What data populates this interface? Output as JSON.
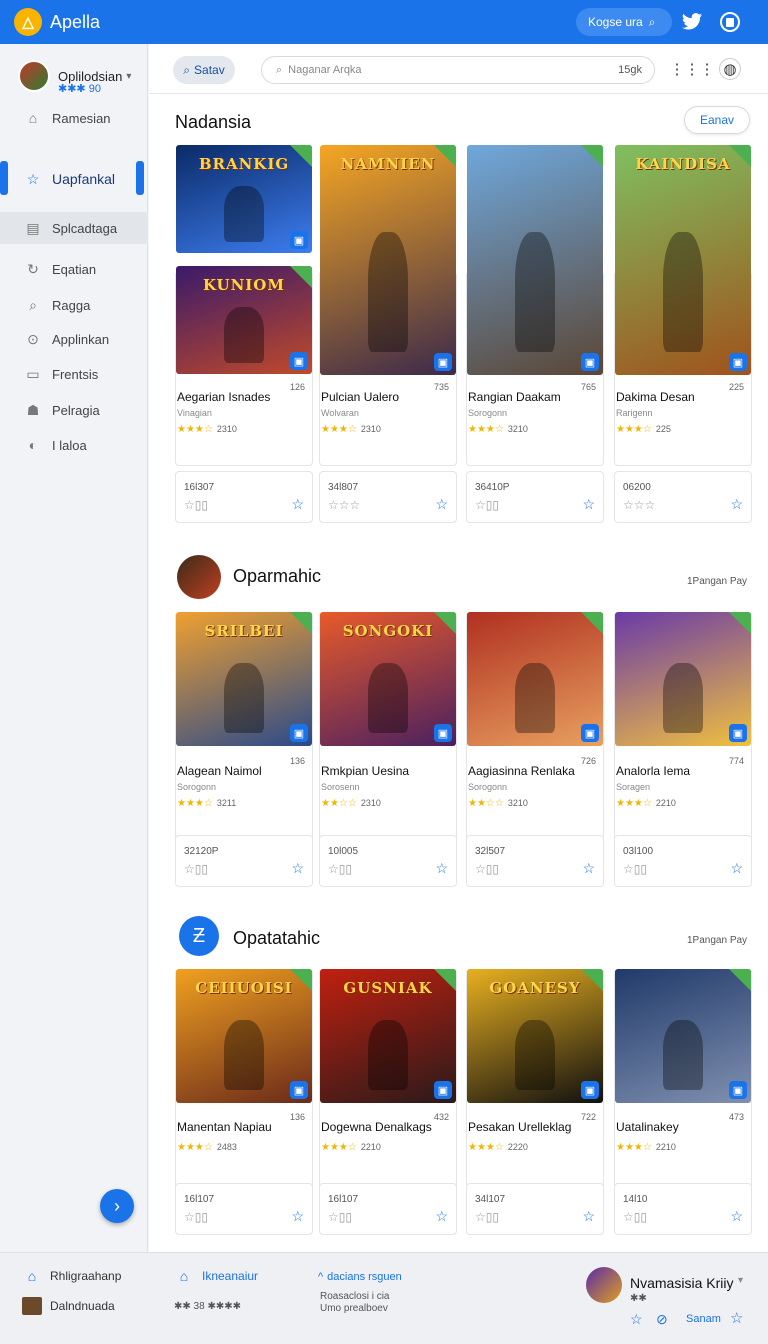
{
  "app": {
    "title": "Apella",
    "logo_glyph": "△"
  },
  "topbar": {
    "search_label": "Kogse ura",
    "search_icon": "search-icon",
    "icons": [
      "twitter-icon",
      "puzzle-icon"
    ]
  },
  "sidebar": {
    "user": {
      "name": "Oplilodsian",
      "score": "✱✱✱ 90"
    },
    "items": [
      {
        "label": "Ramesian",
        "icon": "home-icon"
      },
      {
        "label": "Uapfankal",
        "icon": "star-icon",
        "active": true
      },
      {
        "label": "Splcadtaga",
        "icon": "store-icon",
        "selected": true
      },
      {
        "label": "Eqatian",
        "icon": "update-icon"
      },
      {
        "label": "Ragga",
        "icon": "search-icon"
      },
      {
        "label": "Applinkan",
        "icon": "apps-icon"
      },
      {
        "label": "Frentsis",
        "icon": "library-icon"
      },
      {
        "label": "Pelragia",
        "icon": "people-icon"
      },
      {
        "label": "I laloa",
        "icon": "info-icon"
      }
    ]
  },
  "main": {
    "filter_pill": "Satav",
    "search": {
      "placeholder": "Naganar Arqka",
      "count": "15gk"
    },
    "header_icons": [
      "grid-icon",
      "shield-icon"
    ],
    "sections": [
      {
        "title": "Nadansia",
        "action": "Eanav",
        "games": [
          {
            "name": "Aegarian Isnades",
            "sub": "Vinagian",
            "num": "126",
            "rating": "2310",
            "stars": "★★★☆",
            "price": "16l307",
            "pstars": "☆▯▯",
            "color1": "#0b2a66",
            "color2": "#3d7df0",
            "art_title": "BRANKIG"
          },
          {
            "name": "Pulcian Ualero",
            "sub": "Wolvaran",
            "num": "735",
            "rating": "2310",
            "stars": "★★★☆",
            "price": "34l807",
            "pstars": "☆☆☆",
            "color1": "#f5a623",
            "color2": "#3b2a4a",
            "art_title": "NAMNIEN"
          },
          {
            "name": "Rangian Daakam",
            "sub": "Sorogonn",
            "num": "765",
            "rating": "3210",
            "stars": "★★★☆",
            "price": "36410P",
            "pstars": "☆▯▯",
            "color1": "#6fa8dc",
            "color2": "#5b4636",
            "art_title": ""
          },
          {
            "name": "Dakima Desan",
            "sub": "Rarigenn",
            "num": "225",
            "rating": "225",
            "stars": "★★★☆",
            "price": "06200",
            "pstars": "☆☆☆",
            "color1": "#7fbf5f",
            "color2": "#a0521c",
            "art_title": "KAINDISA"
          }
        ],
        "extra_tile": {
          "color1": "#3a1a6a",
          "color2": "#c04a2a",
          "art_title": "KUNIOM"
        }
      },
      {
        "title": "Oparmahic",
        "action": "1Pangan Pay",
        "games": [
          {
            "name": "Alagean Naimol",
            "sub": "Sorogonn",
            "num": "136",
            "rating": "3211",
            "stars": "★★★☆",
            "price": "32120P",
            "pstars": "☆▯▯",
            "color1": "#f0a030",
            "color2": "#2a4a8a",
            "art_title": "SRILBEI"
          },
          {
            "name": "Rmkpian Uesina",
            "sub": "Sorosenn",
            "num": "",
            "rating": "2310",
            "stars": "★★☆☆",
            "price": "10l005",
            "pstars": "☆▯▯",
            "color1": "#e85a2a",
            "color2": "#4a2060",
            "art_title": "SONGOKI"
          },
          {
            "name": "Aagiasinna Renlaka",
            "sub": "Sorogonn",
            "num": "726",
            "rating": "3210",
            "stars": "★★☆☆",
            "price": "32l507",
            "pstars": "☆▯▯",
            "color1": "#b03020",
            "color2": "#e8a060",
            "art_title": ""
          },
          {
            "name": "Analorla Iema",
            "sub": "Soragen",
            "num": "774",
            "rating": "2210",
            "stars": "★★★☆",
            "price": "03l100",
            "pstars": "☆▯▯",
            "color1": "#6a3aa8",
            "color2": "#f0c040",
            "art_title": ""
          }
        ]
      },
      {
        "title": "Opatatahic",
        "action": "1Pangan Pay",
        "games": [
          {
            "name": "Manentan Napiau",
            "sub": "",
            "num": "136",
            "rating": "2483",
            "stars": "★★★☆",
            "price": "16l107",
            "pstars": "☆▯▯",
            "color1": "#f0a020",
            "color2": "#6a2a1a",
            "art_title": "CEIIUOISI"
          },
          {
            "name": "Dogewna Denalkags",
            "sub": "",
            "num": "432",
            "rating": "2210",
            "stars": "★★★☆",
            "price": "16l107",
            "pstars": "☆▯▯",
            "color1": "#c02010",
            "color2": "#2a1a1a",
            "art_title": "GUSNIAK"
          },
          {
            "name": "Pesakan Urelleklag",
            "sub": "",
            "num": "722",
            "rating": "2220",
            "stars": "★★★☆",
            "price": "34l107",
            "pstars": "☆▯▯",
            "color1": "#e8b020",
            "color2": "#101010",
            "art_title": "GOANESY"
          },
          {
            "name": "Uatalinakey",
            "sub": "",
            "num": "473",
            "rating": "2210",
            "stars": "★★★☆",
            "price": "14l10",
            "pstars": "☆▯▯",
            "color1": "#203a6a",
            "color2": "#8090b0",
            "art_title": ""
          }
        ]
      }
    ]
  },
  "footer": {
    "col1": [
      {
        "label": "Rhligraahanp",
        "icon": "home-icon"
      },
      {
        "label": "Dalndnuada",
        "icon": "avatar-icon"
      }
    ],
    "col2": {
      "title": "Ikneanaiur",
      "line1": "✱✱ 38  ✱✱✱✱"
    },
    "col3": {
      "title": "dacians rsguen",
      "line1": "Roasaclosi i cia",
      "line2": "Umo prealboev"
    },
    "user": {
      "name": "Nvamasisia Kriiy",
      "score": "✱✱",
      "action": "Sanam"
    }
  },
  "colors": {
    "accent": "#1a73e8",
    "topbar": "#1a73e8",
    "star": "#f4b400"
  }
}
